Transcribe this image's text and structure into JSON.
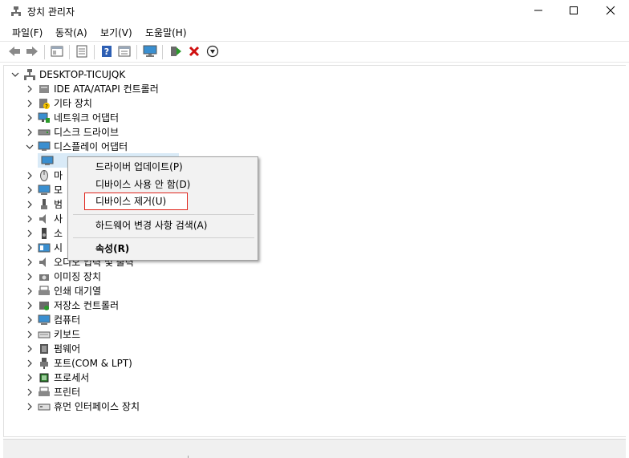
{
  "window": {
    "title": "장치 관리자",
    "controls": {
      "minimize": "minimize-icon",
      "maximize": "maximize-icon",
      "close": "close-icon"
    }
  },
  "menubar": {
    "items": [
      "파일(F)",
      "동작(A)",
      "보기(V)",
      "도움말(H)"
    ]
  },
  "toolbar": {
    "buttons": [
      "back-icon",
      "forward-icon",
      "show-hide-tree-icon",
      "properties-icon",
      "help-icon",
      "view-icon",
      "monitor-icon",
      "update-driver-icon",
      "uninstall-icon",
      "disable-icon"
    ],
    "colors": {
      "uninstall": "#d01010",
      "update": "#2a9a2a"
    }
  },
  "tree": {
    "root": "DESKTOP-TICUJQK",
    "categories": [
      {
        "label": "IDE ATA/ATAPI 컨트롤러",
        "icon": "ide-controller-icon",
        "expanded": false
      },
      {
        "label": "기타 장치",
        "icon": "other-device-icon",
        "expanded": false
      },
      {
        "label": "네트워크 어댑터",
        "icon": "network-adapter-icon",
        "expanded": false
      },
      {
        "label": "디스크 드라이브",
        "icon": "disk-drive-icon",
        "expanded": false
      },
      {
        "label": "디스플레이 어댑터",
        "icon": "display-adapter-icon",
        "expanded": true
      },
      {
        "label": "마",
        "icon": "mouse-icon",
        "expanded": false
      },
      {
        "label": "모",
        "icon": "monitor-icon",
        "expanded": false
      },
      {
        "label": "범",
        "icon": "usb-icon",
        "expanded": false
      },
      {
        "label": "사",
        "icon": "speaker-icon",
        "expanded": false
      },
      {
        "label": "소",
        "icon": "audio-device-icon",
        "expanded": false
      },
      {
        "label": "시",
        "icon": "system-device-icon",
        "expanded": false
      },
      {
        "label": "오디오 입력 및 출력",
        "icon": "audio-io-icon",
        "expanded": false
      },
      {
        "label": "이미징 장치",
        "icon": "camera-icon",
        "expanded": false
      },
      {
        "label": "인쇄 대기열",
        "icon": "print-queue-icon",
        "expanded": false
      },
      {
        "label": "저장소 컨트롤러",
        "icon": "storage-controller-icon",
        "expanded": false
      },
      {
        "label": "컴퓨터",
        "icon": "computer-icon",
        "expanded": false
      },
      {
        "label": "키보드",
        "icon": "keyboard-icon",
        "expanded": false
      },
      {
        "label": "펌웨어",
        "icon": "firmware-icon",
        "expanded": false
      },
      {
        "label": "포트(COM & LPT)",
        "icon": "port-icon",
        "expanded": false
      },
      {
        "label": "프로세서",
        "icon": "processor-icon",
        "expanded": false
      },
      {
        "label": "프린터",
        "icon": "printer-icon",
        "expanded": false
      },
      {
        "label": "휴먼 인터페이스 장치",
        "icon": "hid-icon",
        "expanded": false
      }
    ]
  },
  "context_menu": {
    "items": [
      {
        "label": "드라이버 업데이트(P)"
      },
      {
        "label": "디바이스 사용 안 함(D)"
      },
      {
        "label": "디바이스 제거(U)",
        "highlighted": true
      },
      {
        "label": "하드웨어 변경 사항 검색(A)"
      },
      {
        "label": "속성(R)",
        "bold": true
      }
    ],
    "highlight_color": "#e0261d"
  }
}
